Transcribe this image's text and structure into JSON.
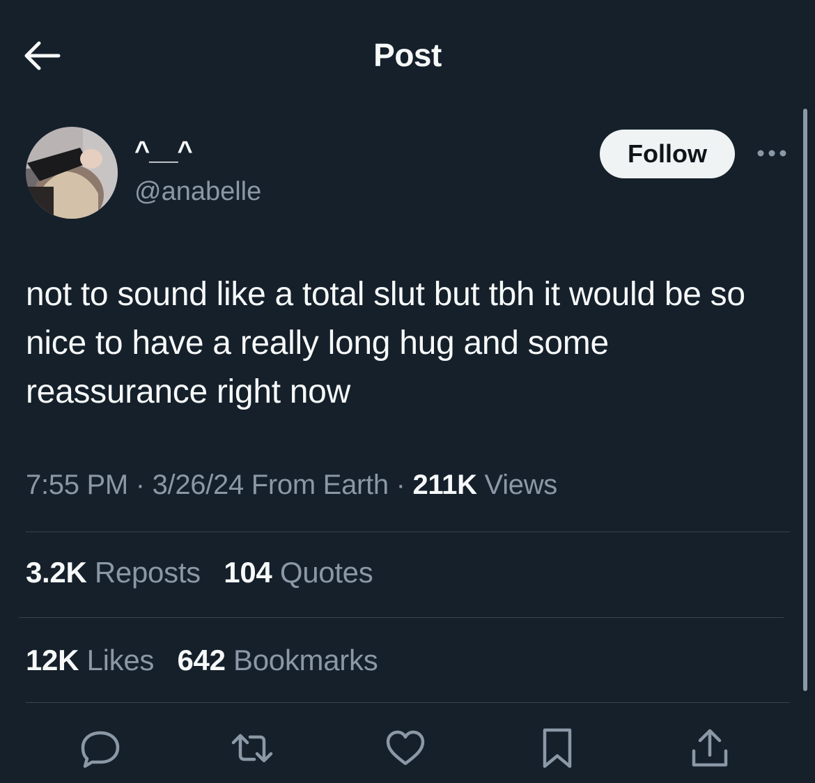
{
  "header": {
    "title": "Post",
    "back_icon": "arrow-left-icon"
  },
  "author": {
    "display_name": "^‿^",
    "display_name_raw": "^__^",
    "handle": "@anabelle",
    "follow_label": "Follow",
    "more_icon": "more-horizontal-icon"
  },
  "post": {
    "text": "not to sound like a total slut but tbh it would be so nice to have a really long hug and some reassurance right now",
    "time": "7:55 PM",
    "date": "3/26/24",
    "source": "From Earth",
    "views_count": "211K",
    "views_label": "Views",
    "sep": "·"
  },
  "stats": {
    "reposts_count": "3.2K",
    "reposts_label": "Reposts",
    "quotes_count": "104",
    "quotes_label": "Quotes",
    "likes_count": "12K",
    "likes_label": "Likes",
    "bookmarks_count": "642",
    "bookmarks_label": "Bookmarks"
  },
  "actions": [
    "reply-icon",
    "repost-icon",
    "like-icon",
    "bookmark-icon",
    "share-icon"
  ],
  "colors": {
    "background": "#15202b",
    "text_primary": "#f7f9f9",
    "text_secondary": "#8b98a5",
    "divider": "#38444d",
    "follow_bg": "#eff3f4"
  }
}
